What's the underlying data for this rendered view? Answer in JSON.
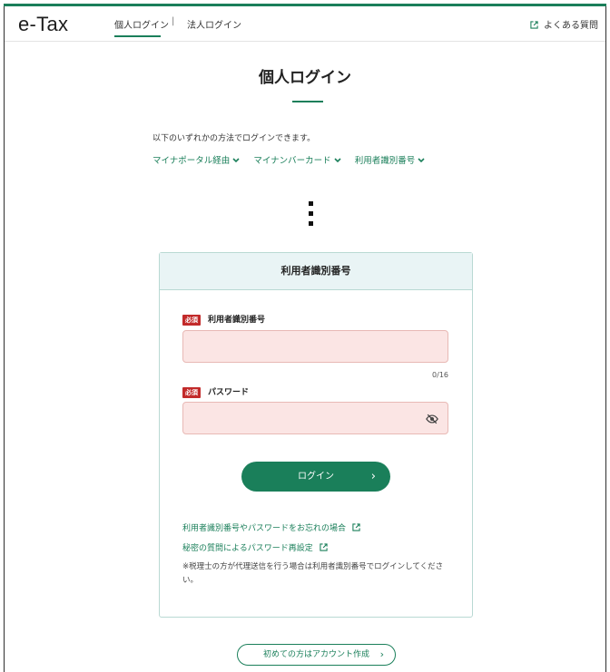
{
  "header": {
    "logo": "e-Tax",
    "nav_personal": "個人ログイン",
    "nav_separator": "|",
    "nav_corporate": "法人ログイン",
    "faq": "よくある質問",
    "faq_icon": "external-link-icon"
  },
  "main": {
    "title": "個人ログイン",
    "intro": "以下のいずれかの方法でログインできます。",
    "methods": [
      {
        "label": "マイナポータル経由"
      },
      {
        "label": "マイナンバーカード"
      },
      {
        "label": "利用者識別番号"
      }
    ]
  },
  "card": {
    "heading": "利用者識別番号",
    "required_badge": "必須",
    "user_id_label": "利用者識別番号",
    "user_id_value": "",
    "counter": "0/16",
    "password_label": "パスワード",
    "password_value": "",
    "password_toggle_icon": "eye-off-icon",
    "login_button": "ログイン",
    "login_arrow": "›",
    "link_forgot": "利用者識別番号やパスワードをお忘れの場合",
    "link_reset": "秘密の質問によるパスワード再設定",
    "note": "※税理士の方が代理送信を行う場合は利用者識別番号でログインしてください。"
  },
  "footer": {
    "signup_button": "初めての方はアカウント作成",
    "signup_arrow": "›"
  },
  "colors": {
    "brand_green": "#1a7f5a",
    "required_red": "#c22a2a",
    "input_bg": "#fbe5e4",
    "card_head_bg": "#e9f4f5"
  }
}
